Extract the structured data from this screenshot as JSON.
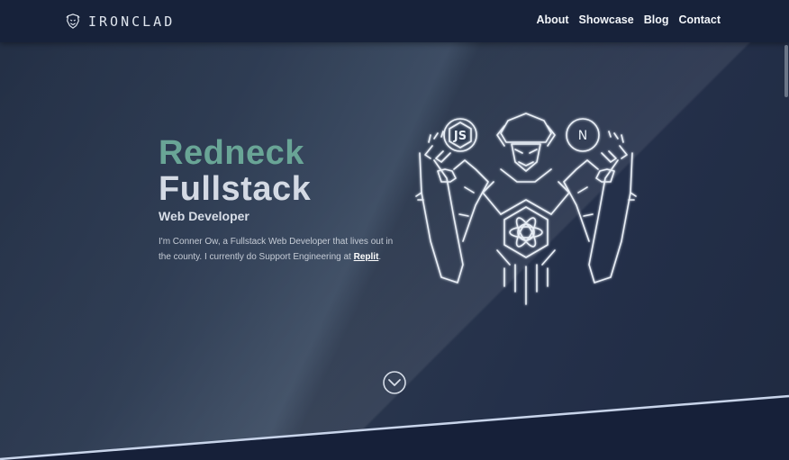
{
  "nav": {
    "brand": "IRONCLAD",
    "links": [
      "About",
      "Showcase",
      "Blog",
      "Contact"
    ]
  },
  "hero": {
    "title_line1": "Redneck",
    "title_line2": "Fullstack",
    "subtitle": "Web Developer",
    "intro_before": "I'm Conner Ow, a Fullstack Web Developer that lives out in the county. I currently do Support Engineering at ",
    "intro_link": "Replit",
    "intro_after": ".",
    "robot_badges": [
      "JS",
      "N"
    ]
  },
  "colors": {
    "accent_green": "#69a596",
    "nav_bg": "#17223a",
    "page_bg": "#1d2940"
  },
  "icons": [
    "brand-logo-icon",
    "chevron-down-icon",
    "robot-illustration"
  ]
}
